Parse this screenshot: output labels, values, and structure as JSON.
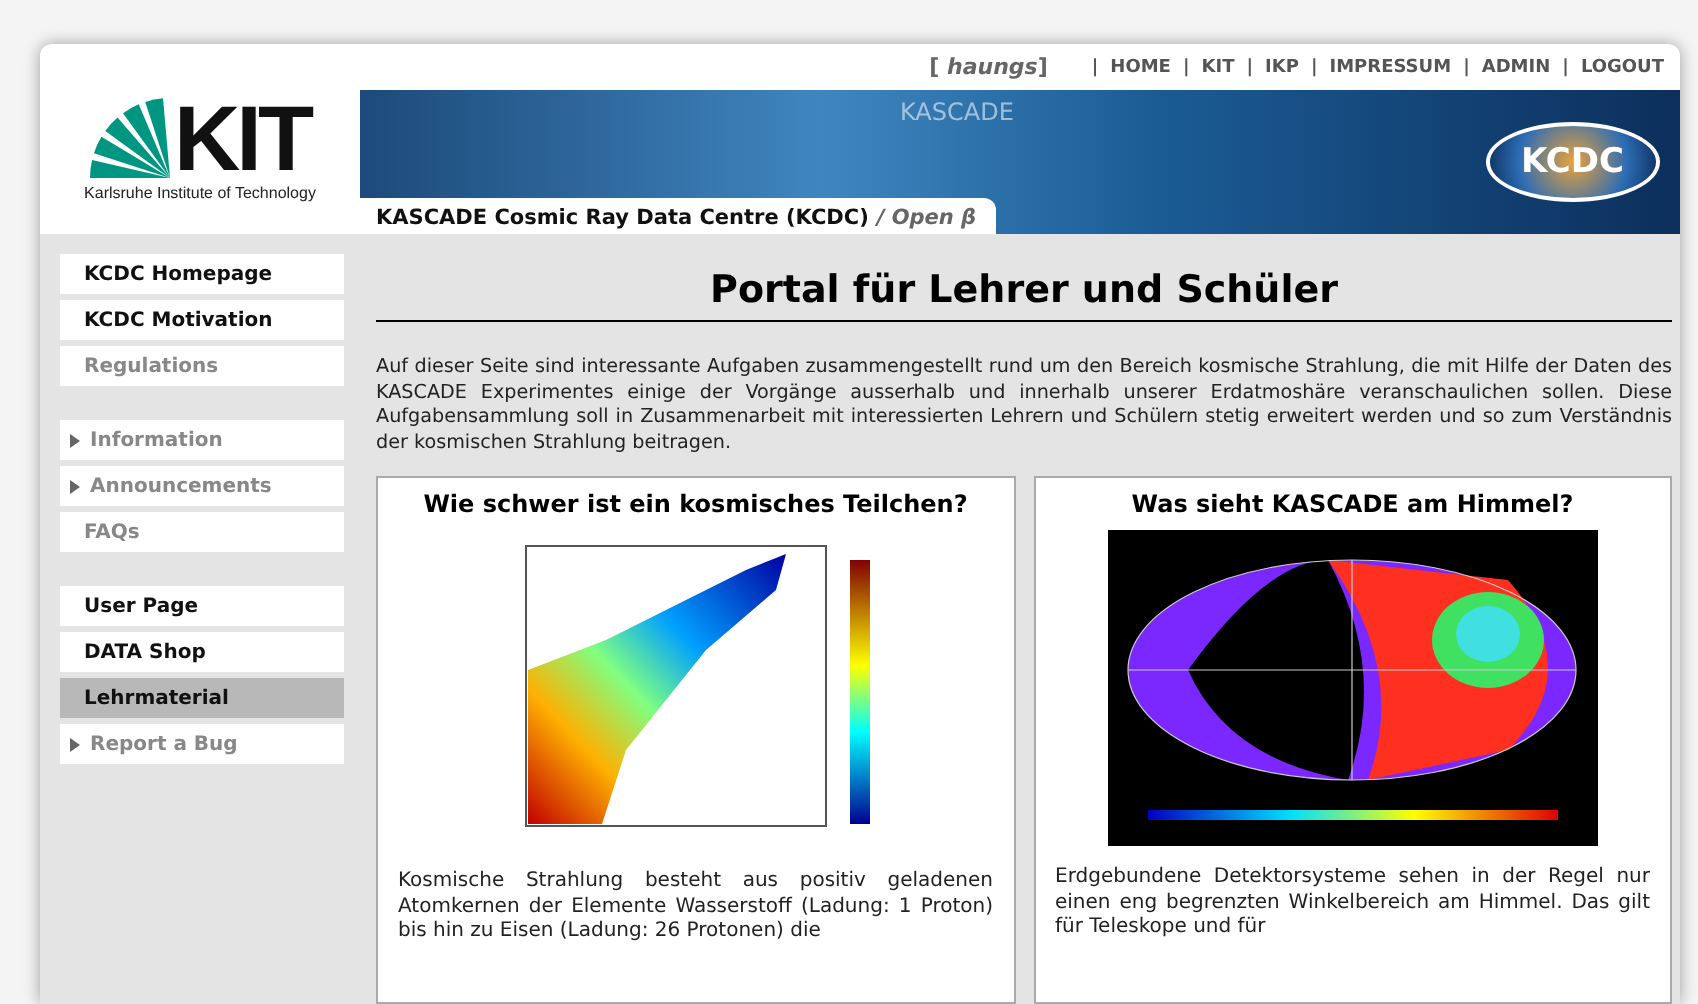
{
  "user": "[ *haungs*]",
  "top_links": [
    {
      "sep": "|",
      "label": "HOME"
    },
    {
      "sep": "|",
      "label": "KIT"
    },
    {
      "sep": "|",
      "label": "IKP"
    },
    {
      "sep": "|",
      "label": "IMPRESSUM"
    },
    {
      "sep": "|",
      "label": "ADMIN"
    },
    {
      "sep": "|",
      "label": "LOGOUT"
    }
  ],
  "logo": {
    "text": "KIT",
    "caption": "Karlsruhe Institute of Technology"
  },
  "banner": {
    "title": "KASCADE Cosmic Ray Data Centre (KCDC)",
    "suffix": "/ Open β",
    "watermark": "KASCADE",
    "badge": "KCDC"
  },
  "sidebar": {
    "groups": [
      [
        {
          "label": "KCDC Homepage",
          "expandable": false,
          "dim": false,
          "selected": false
        },
        {
          "label": "KCDC Motivation",
          "expandable": false,
          "dim": false,
          "selected": false
        },
        {
          "label": "Regulations",
          "expandable": false,
          "dim": true,
          "selected": false
        }
      ],
      [
        {
          "label": "Information",
          "expandable": true,
          "dim": true,
          "selected": false
        },
        {
          "label": "Announcements",
          "expandable": true,
          "dim": true,
          "selected": false
        },
        {
          "label": "FAQs",
          "expandable": false,
          "dim": true,
          "selected": false
        }
      ],
      [
        {
          "label": "User Page",
          "expandable": false,
          "dim": false,
          "selected": false
        },
        {
          "label": "DATA Shop",
          "expandable": false,
          "dim": false,
          "selected": false
        },
        {
          "label": "Lehrmaterial",
          "expandable": false,
          "dim": false,
          "selected": true
        },
        {
          "label": "Report a Bug",
          "expandable": true,
          "dim": true,
          "selected": false
        }
      ]
    ]
  },
  "page": {
    "title": "Portal für Lehrer und Schüler",
    "intro": "Auf dieser Seite sind interessante Aufgaben zusammengestellt rund um den Bereich kosmische Strahlung, die mit Hilfe der Daten des KASCADE Experimentes einige der Vorgänge ausserhalb und innerhalb unserer Erdatmoshäre veranschaulichen sollen. Diese Aufgabensammlung soll in Zusammenarbeit mit interessierten Lehrern und Schülern stetig erweitert werden und so zum Verständnis der kosmischen Strahlung beitragen.",
    "cards": [
      {
        "kind": "scatter",
        "title": "Wie schwer ist ein kosmisches Teilchen?",
        "text": "Kosmische Strahlung besteht aus positiv geladenen Atomkernen der Elemente Wasserstoff (Ladung: 1 Proton) bis hin zu Eisen (Ladung: 26 Protonen) die"
      },
      {
        "kind": "skymap",
        "title": "Was sieht KASCADE am Himmel?",
        "text": "Erdgebundene Detektorsysteme sehen in der Regel nur einen eng begrenzten Winkelbereich am Himmel. Das gilt für Teleskope und für"
      }
    ]
  }
}
